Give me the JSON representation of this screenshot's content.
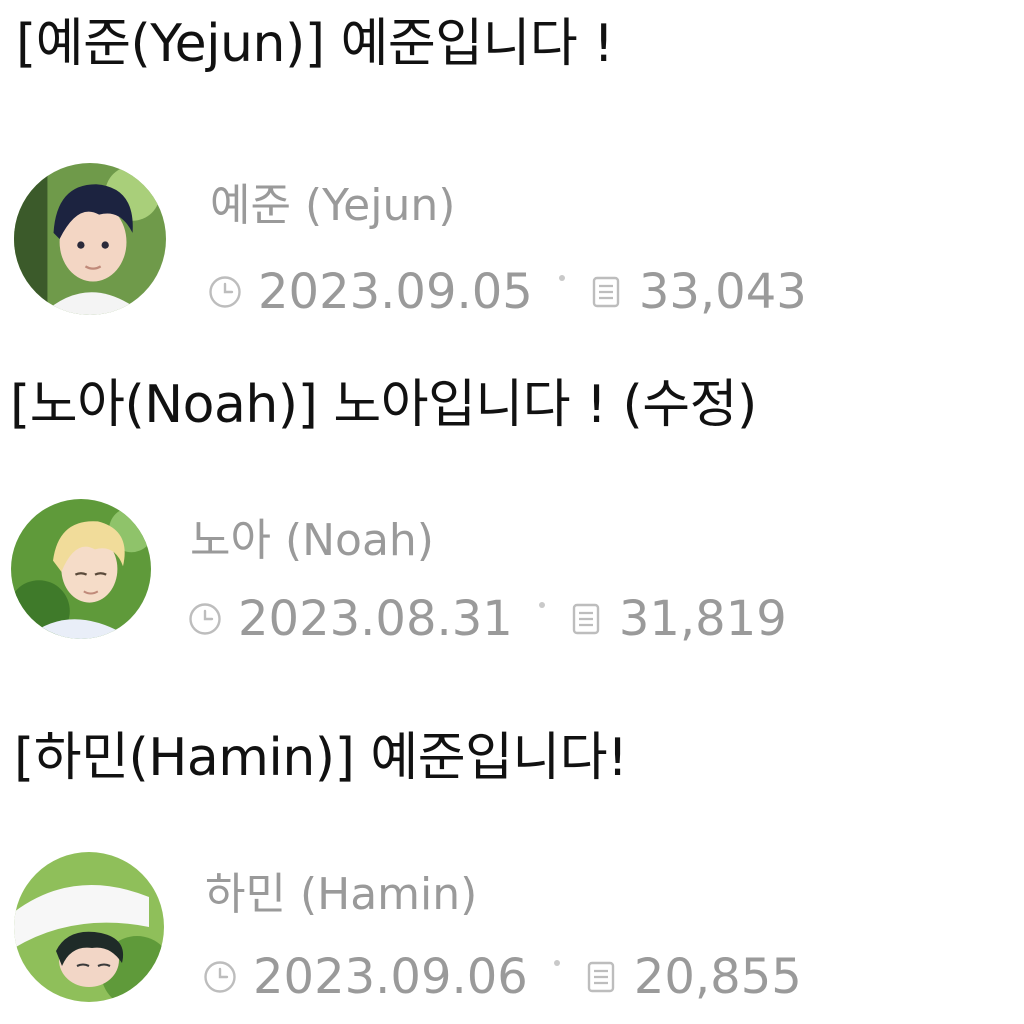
{
  "posts": [
    {
      "title": "[예준(Yejun)] 예준입니다 !",
      "author": "예준 (Yejun)",
      "date": "2023.09.05",
      "views": "33,043",
      "avatar_icon": "avatar-yejun",
      "avatar_colors": {
        "bg": "#6f9a4a",
        "hair": "#1c2340",
        "skin": "#f3d6c4",
        "shirt": "#f4f4f4"
      }
    },
    {
      "title": "[노아(Noah)] 노아입니다 ! (수정)",
      "author": "노아 (Noah)",
      "date": "2023.08.31",
      "views": "31,819",
      "avatar_icon": "avatar-noah",
      "avatar_colors": {
        "bg": "#5f9a3a",
        "hair": "#f1dc9a",
        "skin": "#f5dcc8",
        "shirt": "#e9eef8"
      }
    },
    {
      "title": "[하민(Hamin)] 예준입니다!",
      "author": "하민 (Hamin)",
      "date": "2023.09.06",
      "views": "20,855",
      "avatar_icon": "avatar-hamin",
      "avatar_colors": {
        "bg": "#8fbf5a",
        "hair": "#1f2b28",
        "skin": "#f2d6c6",
        "shirt": "#f7f7f7"
      }
    }
  ],
  "icons": {
    "date": "clock-icon",
    "views": "document-icon"
  },
  "colors": {
    "title": "#111111",
    "meta": "#9a9a9a",
    "icon": "#bdbdbd"
  }
}
